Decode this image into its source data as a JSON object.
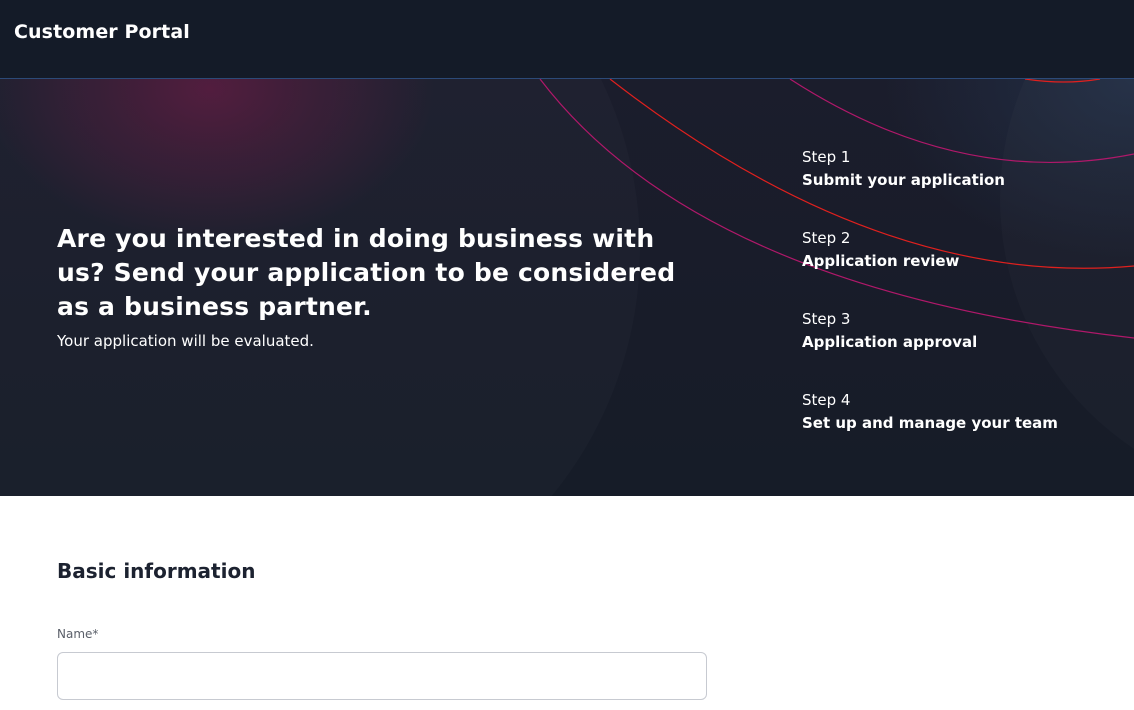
{
  "header": {
    "title": "Customer Portal"
  },
  "hero": {
    "headline": "Are you interested in doing business with us? Send your application to be considered as a business partner.",
    "subtitle": "Your application will be evaluated.",
    "steps": [
      {
        "number": "Step 1",
        "title": "Submit your application"
      },
      {
        "number": "Step 2",
        "title": "Application review"
      },
      {
        "number": "Step 3",
        "title": "Application approval"
      },
      {
        "number": "Step 4",
        "title": "Set up and manage your team"
      }
    ]
  },
  "form": {
    "section_title": "Basic information",
    "fields": [
      {
        "label": "Name*",
        "value": "",
        "placeholder": ""
      }
    ]
  },
  "colors": {
    "header_bg": "#141b28",
    "hero_bg": "#181c29",
    "accent_red": "#e0201e",
    "accent_magenta": "#b0186a"
  }
}
